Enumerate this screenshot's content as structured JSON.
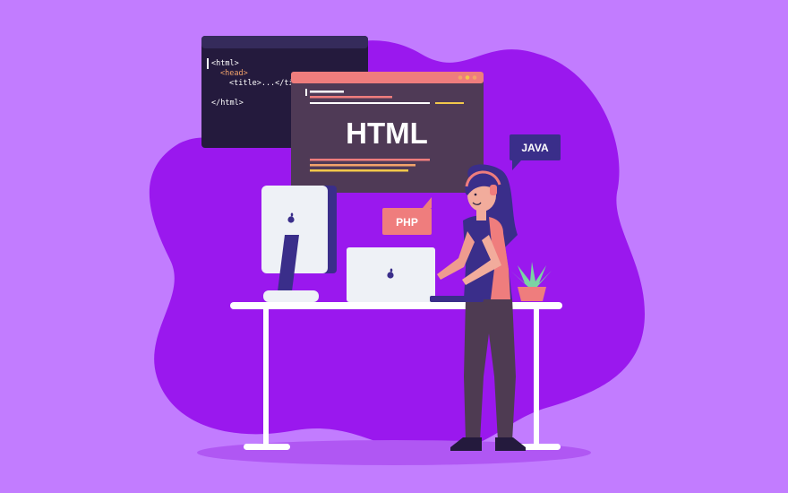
{
  "colors": {
    "background": "#c27cff",
    "blob": "#9a18ee",
    "shadow": "#b057f3",
    "code_window": "#241a3d",
    "code_window_bar": "#352b5b",
    "html_window": "#4f3a56",
    "html_window_bar": "#ef7d7d",
    "accent_pink": "#ef7d7d",
    "accent_orange": "#f2a36b",
    "accent_yellow": "#f2c84b",
    "desk": "#ffffff",
    "device": "#eef1f6",
    "device_shadow": "#3a2e8a",
    "java_bubble": "#3a2e8a",
    "php_bubble": "#ef7d7d"
  },
  "code_window": {
    "line1": "<html>",
    "line2": "<head>",
    "line3": "<title>...</title>",
    "line4": "</html>"
  },
  "html_window": {
    "title": "HTML"
  },
  "bubbles": {
    "java": "JAVA",
    "php": "PHP"
  },
  "icons": {
    "monitor_logo": "apple-logo-icon",
    "laptop_logo": "apple-logo-icon",
    "window_dots": "window-control-dots-icon",
    "plant": "potted-plant-icon"
  }
}
